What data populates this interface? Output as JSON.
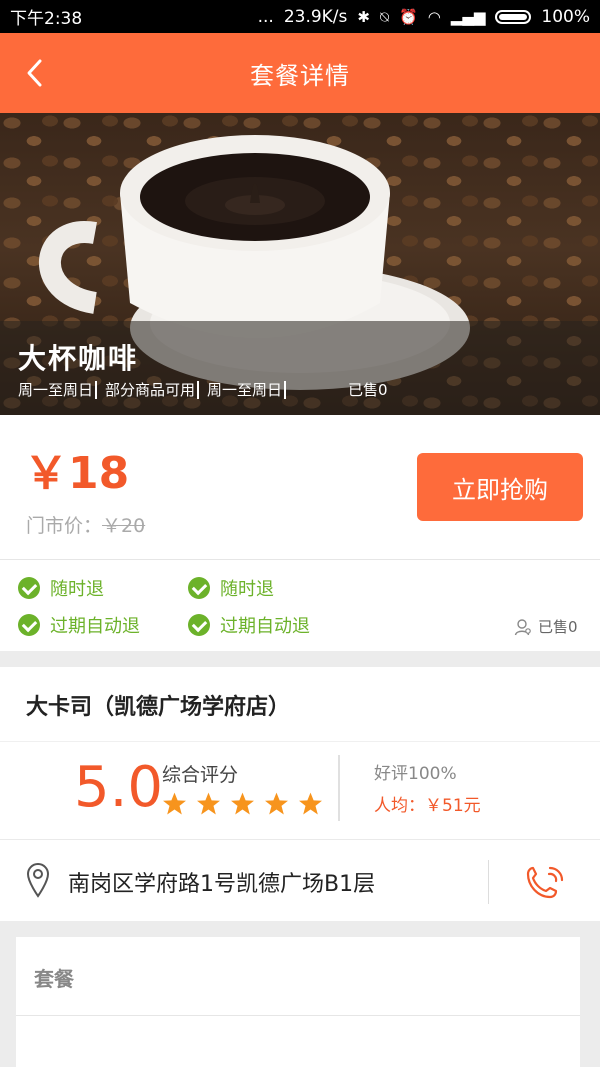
{
  "status_bar": {
    "time": "下午2:38",
    "dots": "...",
    "speed": "23.9K/s",
    "battery": "100%"
  },
  "header": {
    "title": "套餐详情"
  },
  "hero": {
    "name": "大杯咖啡",
    "tags": [
      "周一至周日",
      "部分商品可用",
      "周一至周日"
    ],
    "sold": "已售0"
  },
  "price": {
    "current": "￥18",
    "original_label": "门市价：",
    "original_value": "￥20",
    "buy_button": "立即抢购"
  },
  "features": {
    "items": [
      "随时退",
      "随时退",
      "过期自动退",
      "过期自动退"
    ],
    "sold": "已售0"
  },
  "shop": {
    "name": "大卡司（凯德广场学府店）",
    "score": "5.0",
    "score_label": "综合评分",
    "stars": 5,
    "good_rate": "好评100%",
    "avg_price": "人均：￥51元"
  },
  "address": {
    "text": "南岗区学府路1号凯德广场B1层"
  },
  "package": {
    "title": "套餐"
  },
  "colors": {
    "accent": "#fe6b3b",
    "price": "#f2592a",
    "green": "#6cb22a",
    "star": "#f7941d"
  }
}
